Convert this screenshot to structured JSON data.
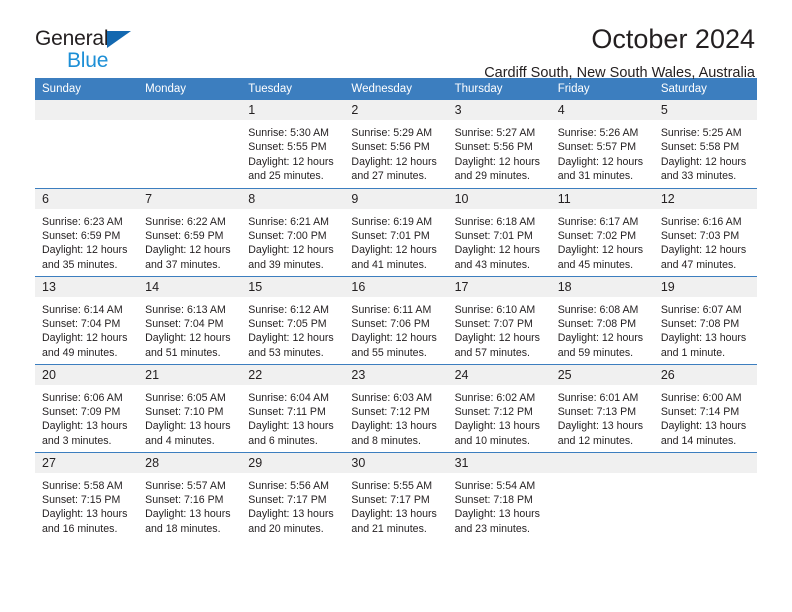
{
  "brand": {
    "name_part1": "General",
    "name_part2": "Blue",
    "triangle_color": "#1368b0",
    "blue_text_color": "#1d8fd6"
  },
  "header": {
    "title": "October 2024",
    "location": "Cardiff South, New South Wales, Australia"
  },
  "theme": {
    "header_bg": "#3c7ebf",
    "daynum_bg": "#f0f0f0",
    "text": "#231f20"
  },
  "weekday_headers": [
    "Sunday",
    "Monday",
    "Tuesday",
    "Wednesday",
    "Thursday",
    "Friday",
    "Saturday"
  ],
  "weeks": [
    [
      {
        "day": "",
        "empty": true,
        "lines": []
      },
      {
        "day": "",
        "empty": true,
        "lines": []
      },
      {
        "day": "1",
        "lines": [
          "Sunrise: 5:30 AM",
          "Sunset: 5:55 PM",
          "Daylight: 12 hours",
          "and 25 minutes."
        ]
      },
      {
        "day": "2",
        "lines": [
          "Sunrise: 5:29 AM",
          "Sunset: 5:56 PM",
          "Daylight: 12 hours",
          "and 27 minutes."
        ]
      },
      {
        "day": "3",
        "lines": [
          "Sunrise: 5:27 AM",
          "Sunset: 5:56 PM",
          "Daylight: 12 hours",
          "and 29 minutes."
        ]
      },
      {
        "day": "4",
        "lines": [
          "Sunrise: 5:26 AM",
          "Sunset: 5:57 PM",
          "Daylight: 12 hours",
          "and 31 minutes."
        ]
      },
      {
        "day": "5",
        "lines": [
          "Sunrise: 5:25 AM",
          "Sunset: 5:58 PM",
          "Daylight: 12 hours",
          "and 33 minutes."
        ]
      }
    ],
    [
      {
        "day": "6",
        "lines": [
          "Sunrise: 6:23 AM",
          "Sunset: 6:59 PM",
          "Daylight: 12 hours",
          "and 35 minutes."
        ]
      },
      {
        "day": "7",
        "lines": [
          "Sunrise: 6:22 AM",
          "Sunset: 6:59 PM",
          "Daylight: 12 hours",
          "and 37 minutes."
        ]
      },
      {
        "day": "8",
        "lines": [
          "Sunrise: 6:21 AM",
          "Sunset: 7:00 PM",
          "Daylight: 12 hours",
          "and 39 minutes."
        ]
      },
      {
        "day": "9",
        "lines": [
          "Sunrise: 6:19 AM",
          "Sunset: 7:01 PM",
          "Daylight: 12 hours",
          "and 41 minutes."
        ]
      },
      {
        "day": "10",
        "lines": [
          "Sunrise: 6:18 AM",
          "Sunset: 7:01 PM",
          "Daylight: 12 hours",
          "and 43 minutes."
        ]
      },
      {
        "day": "11",
        "lines": [
          "Sunrise: 6:17 AM",
          "Sunset: 7:02 PM",
          "Daylight: 12 hours",
          "and 45 minutes."
        ]
      },
      {
        "day": "12",
        "lines": [
          "Sunrise: 6:16 AM",
          "Sunset: 7:03 PM",
          "Daylight: 12 hours",
          "and 47 minutes."
        ]
      }
    ],
    [
      {
        "day": "13",
        "lines": [
          "Sunrise: 6:14 AM",
          "Sunset: 7:04 PM",
          "Daylight: 12 hours",
          "and 49 minutes."
        ]
      },
      {
        "day": "14",
        "lines": [
          "Sunrise: 6:13 AM",
          "Sunset: 7:04 PM",
          "Daylight: 12 hours",
          "and 51 minutes."
        ]
      },
      {
        "day": "15",
        "lines": [
          "Sunrise: 6:12 AM",
          "Sunset: 7:05 PM",
          "Daylight: 12 hours",
          "and 53 minutes."
        ]
      },
      {
        "day": "16",
        "lines": [
          "Sunrise: 6:11 AM",
          "Sunset: 7:06 PM",
          "Daylight: 12 hours",
          "and 55 minutes."
        ]
      },
      {
        "day": "17",
        "lines": [
          "Sunrise: 6:10 AM",
          "Sunset: 7:07 PM",
          "Daylight: 12 hours",
          "and 57 minutes."
        ]
      },
      {
        "day": "18",
        "lines": [
          "Sunrise: 6:08 AM",
          "Sunset: 7:08 PM",
          "Daylight: 12 hours",
          "and 59 minutes."
        ]
      },
      {
        "day": "19",
        "lines": [
          "Sunrise: 6:07 AM",
          "Sunset: 7:08 PM",
          "Daylight: 13 hours",
          "and 1 minute."
        ]
      }
    ],
    [
      {
        "day": "20",
        "lines": [
          "Sunrise: 6:06 AM",
          "Sunset: 7:09 PM",
          "Daylight: 13 hours",
          "and 3 minutes."
        ]
      },
      {
        "day": "21",
        "lines": [
          "Sunrise: 6:05 AM",
          "Sunset: 7:10 PM",
          "Daylight: 13 hours",
          "and 4 minutes."
        ]
      },
      {
        "day": "22",
        "lines": [
          "Sunrise: 6:04 AM",
          "Sunset: 7:11 PM",
          "Daylight: 13 hours",
          "and 6 minutes."
        ]
      },
      {
        "day": "23",
        "lines": [
          "Sunrise: 6:03 AM",
          "Sunset: 7:12 PM",
          "Daylight: 13 hours",
          "and 8 minutes."
        ]
      },
      {
        "day": "24",
        "lines": [
          "Sunrise: 6:02 AM",
          "Sunset: 7:12 PM",
          "Daylight: 13 hours",
          "and 10 minutes."
        ]
      },
      {
        "day": "25",
        "lines": [
          "Sunrise: 6:01 AM",
          "Sunset: 7:13 PM",
          "Daylight: 13 hours",
          "and 12 minutes."
        ]
      },
      {
        "day": "26",
        "lines": [
          "Sunrise: 6:00 AM",
          "Sunset: 7:14 PM",
          "Daylight: 13 hours",
          "and 14 minutes."
        ]
      }
    ],
    [
      {
        "day": "27",
        "lines": [
          "Sunrise: 5:58 AM",
          "Sunset: 7:15 PM",
          "Daylight: 13 hours",
          "and 16 minutes."
        ]
      },
      {
        "day": "28",
        "lines": [
          "Sunrise: 5:57 AM",
          "Sunset: 7:16 PM",
          "Daylight: 13 hours",
          "and 18 minutes."
        ]
      },
      {
        "day": "29",
        "lines": [
          "Sunrise: 5:56 AM",
          "Sunset: 7:17 PM",
          "Daylight: 13 hours",
          "and 20 minutes."
        ]
      },
      {
        "day": "30",
        "lines": [
          "Sunrise: 5:55 AM",
          "Sunset: 7:17 PM",
          "Daylight: 13 hours",
          "and 21 minutes."
        ]
      },
      {
        "day": "31",
        "lines": [
          "Sunrise: 5:54 AM",
          "Sunset: 7:18 PM",
          "Daylight: 13 hours",
          "and 23 minutes."
        ]
      },
      {
        "day": "",
        "empty": true,
        "lines": []
      },
      {
        "day": "",
        "empty": true,
        "lines": []
      }
    ]
  ]
}
